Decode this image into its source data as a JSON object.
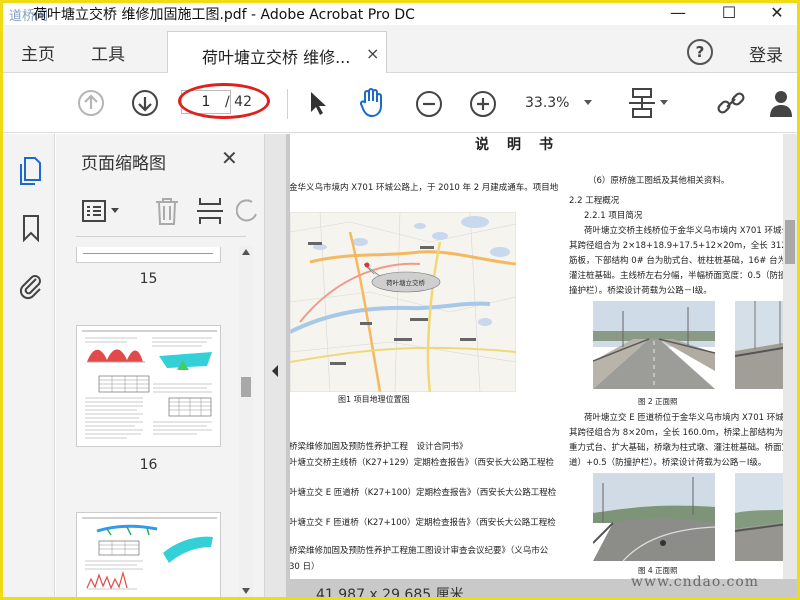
{
  "window": {
    "title": "荷叶塘立交桥 维修加固施工图.pdf - Adobe Acrobat Pro DC",
    "watermark_logo": "道桥网",
    "min_glyph": "—",
    "max_glyph": "☐",
    "close_glyph": "✕"
  },
  "menu": {
    "home": "主页",
    "tools": "工具",
    "tab_title": "荷叶塘立交桥 维修...",
    "tab_close": "×",
    "help": "?",
    "login": "登录"
  },
  "toolbar": {
    "current_page": "1",
    "total_pages": "/ 42",
    "zoom": "33.3%",
    "oval_color": "#e0201c",
    "accent_color": "#1b6ac9"
  },
  "thumbnails": {
    "header": "页面缩略图",
    "close": "✕",
    "pages": [
      "15",
      "16"
    ]
  },
  "document": {
    "heading": "说　明　书",
    "left_col": [
      "金华义乌市境内 X701 环城公路上，于 2010 年 2 月建成通车。项目地",
      "图1  项目地理位置图",
      "桥梁维修加固及预防性养护工程　设计合同书》",
      "叶塘立交桥主线桥（K27+129）定期检查报告》（西安长大公路工程检",
      "叶塘立交 E 匝道桥（K27+100）定期检查报告》（西安长大公路工程检",
      "叶塘立交 F 匝道桥（K27+100）定期检查报告》（西安长大公路工程检",
      "桥梁维修加固及预防性养护工程施工图设计审查会议纪要》（义乌市公",
      "30 日）"
    ],
    "map_callout": "荷叶塘立交桥",
    "right_col": [
      "（6）原桥施工图纸及其他相关资料。",
      "2.2 工程概况",
      "2.2.1 项目简况",
      "荷叶塘立交桥主线桥位于金华义乌市境内 X701 环城公路上",
      "其跨径组合为 2×18+18.9+17.5+12×20m，全长 312.4m，桥梁上",
      "筋板，下部结构 0# 台为肋式台、桩柱桩基础，16# 台为重力式台",
      "灌注桩基础。主线桥左右分幅，半幅桥面宽度：0.5（防撞护栏",
      "撞护栏）。桥梁设计荷载为公路－Ⅰ级。",
      "图 2  正面照",
      "荷叶塘立交 E 匝道桥位于金华义乌市境内 X701 环城公路，",
      "其跨径组合为 8×20m，全长 160.0m，桥梁上部结构为普通钢筋",
      "重力式台、扩大基础，桥墩为柱式墩、灌注桩基础。桥面宽度：",
      "道）+0.5（防撞护栏）。桥梁设计荷载为公路－Ⅰ级。",
      "图 4  正面照"
    ]
  },
  "status": {
    "page_size": "41.987 x 29.685 厘米",
    "site_watermark": "www.cndao.com"
  }
}
